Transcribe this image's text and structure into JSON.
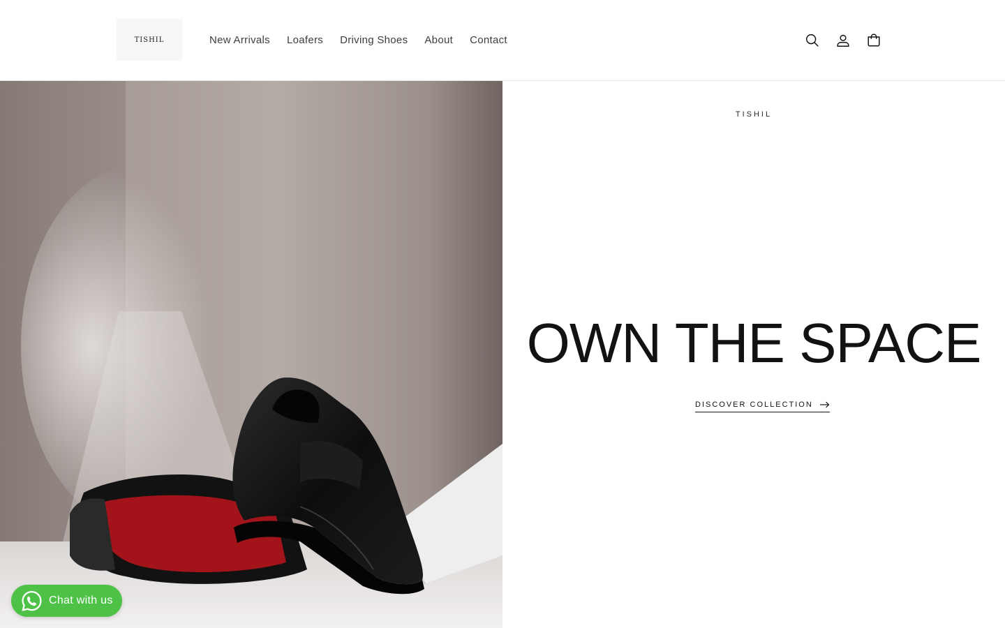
{
  "header": {
    "logo_text": "TISHIL",
    "nav": [
      "New Arrivals",
      "Loafers",
      "Driving Shoes",
      "About",
      "Contact"
    ],
    "icons": [
      "search-icon",
      "account-icon",
      "cart-icon"
    ]
  },
  "hero": {
    "brand": "TISHIL",
    "headline": "OWN THE SPACE",
    "cta_label": "DISCOVER COLLECTION",
    "cta_icon": "arrow-right-icon",
    "image_alt": "black-loafer-red-sole"
  },
  "chat": {
    "label": "Chat with us",
    "icon": "whatsapp-icon",
    "color": "#4dc247"
  },
  "colors": {
    "text": "#121212",
    "nav_text": "#3d3d3d",
    "sole_red": "#b3151a"
  }
}
